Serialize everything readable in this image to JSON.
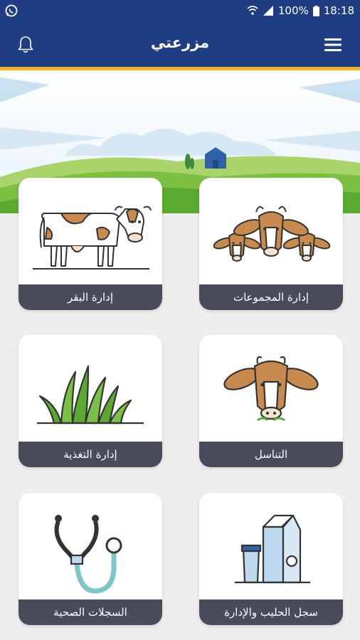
{
  "status_bar": {
    "battery": "100%",
    "time": "18:18"
  },
  "app_bar": {
    "title": "مزرعتي"
  },
  "cards": [
    {
      "label": "إدارة المجموعات",
      "icon": "cow-group-icon"
    },
    {
      "label": "إدارة البقر",
      "icon": "dairy-cow-icon"
    },
    {
      "label": "التناسل",
      "icon": "cow-head-icon"
    },
    {
      "label": "إدارة التغذية",
      "icon": "grass-icon"
    },
    {
      "label": "سجل الحليب والإدارة",
      "icon": "milk-carton-icon"
    },
    {
      "label": "السجلات الصحية",
      "icon": "stethoscope-icon"
    }
  ],
  "colors": {
    "primary": "#1f3d82",
    "accent": "#f2b221",
    "label_bg": "#474b5a",
    "cow_brown": "#c98a4e"
  }
}
